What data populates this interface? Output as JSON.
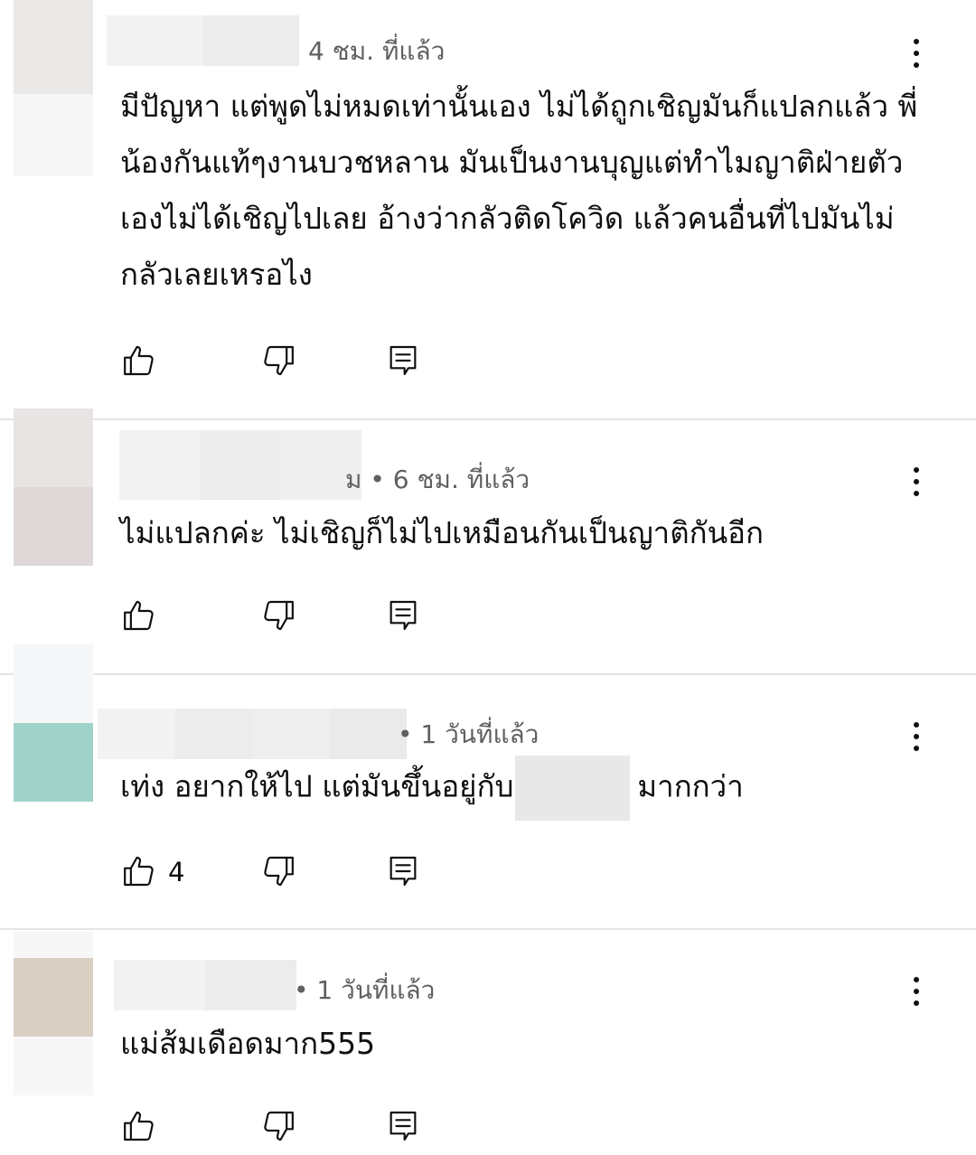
{
  "comments": [
    {
      "timestamp": "4 ชม. ที่แล้ว",
      "text": "มีปัญหา แต่พูดไม่หมดเท่านั้นเอง  ไม่ได้ถูกเชิญมันก็แปลกแล้ว พี่น้องกันแท้ๆงานบวชหลาน มันเป็นงานบุญแต่ทำไมญาติฝ่ายตัวเองไม่ได้เชิญไปเลย อ้างว่ากลัวติดโควิด แล้วคนอื่นที่ไปมันไม่กลัวเลยเหรอไง",
      "likes": ""
    },
    {
      "timestamp": "ม • 6 ชม. ที่แล้ว",
      "text": "ไม่แปลกค่ะ ไม่เชิญก็ไม่ไปเหมือนกันเป็นญาติกันอีก",
      "likes": ""
    },
    {
      "timestamp": "• 1 วันที่แล้ว",
      "text_before": "เท่ง อยากให้ไป แต่มันขึ้นอยู่กับ",
      "text_after": "มากกว่า",
      "likes": "4"
    },
    {
      "timestamp": "• 1 วันที่แล้ว",
      "text": "แม่ส้มเดือดมาก555",
      "likes": ""
    }
  ],
  "icons": {
    "like": "thumb-up-icon",
    "dislike": "thumb-down-icon",
    "reply": "reply-comment-icon",
    "more": "more-vert-icon"
  },
  "colors": {
    "text": "#0f0f0f",
    "meta": "#606060",
    "divider": "#e5e5e5",
    "redaction": "#e8e8e8",
    "avatar_teal": "#a0d2c9",
    "avatar_tan": "#d9cfc3"
  }
}
